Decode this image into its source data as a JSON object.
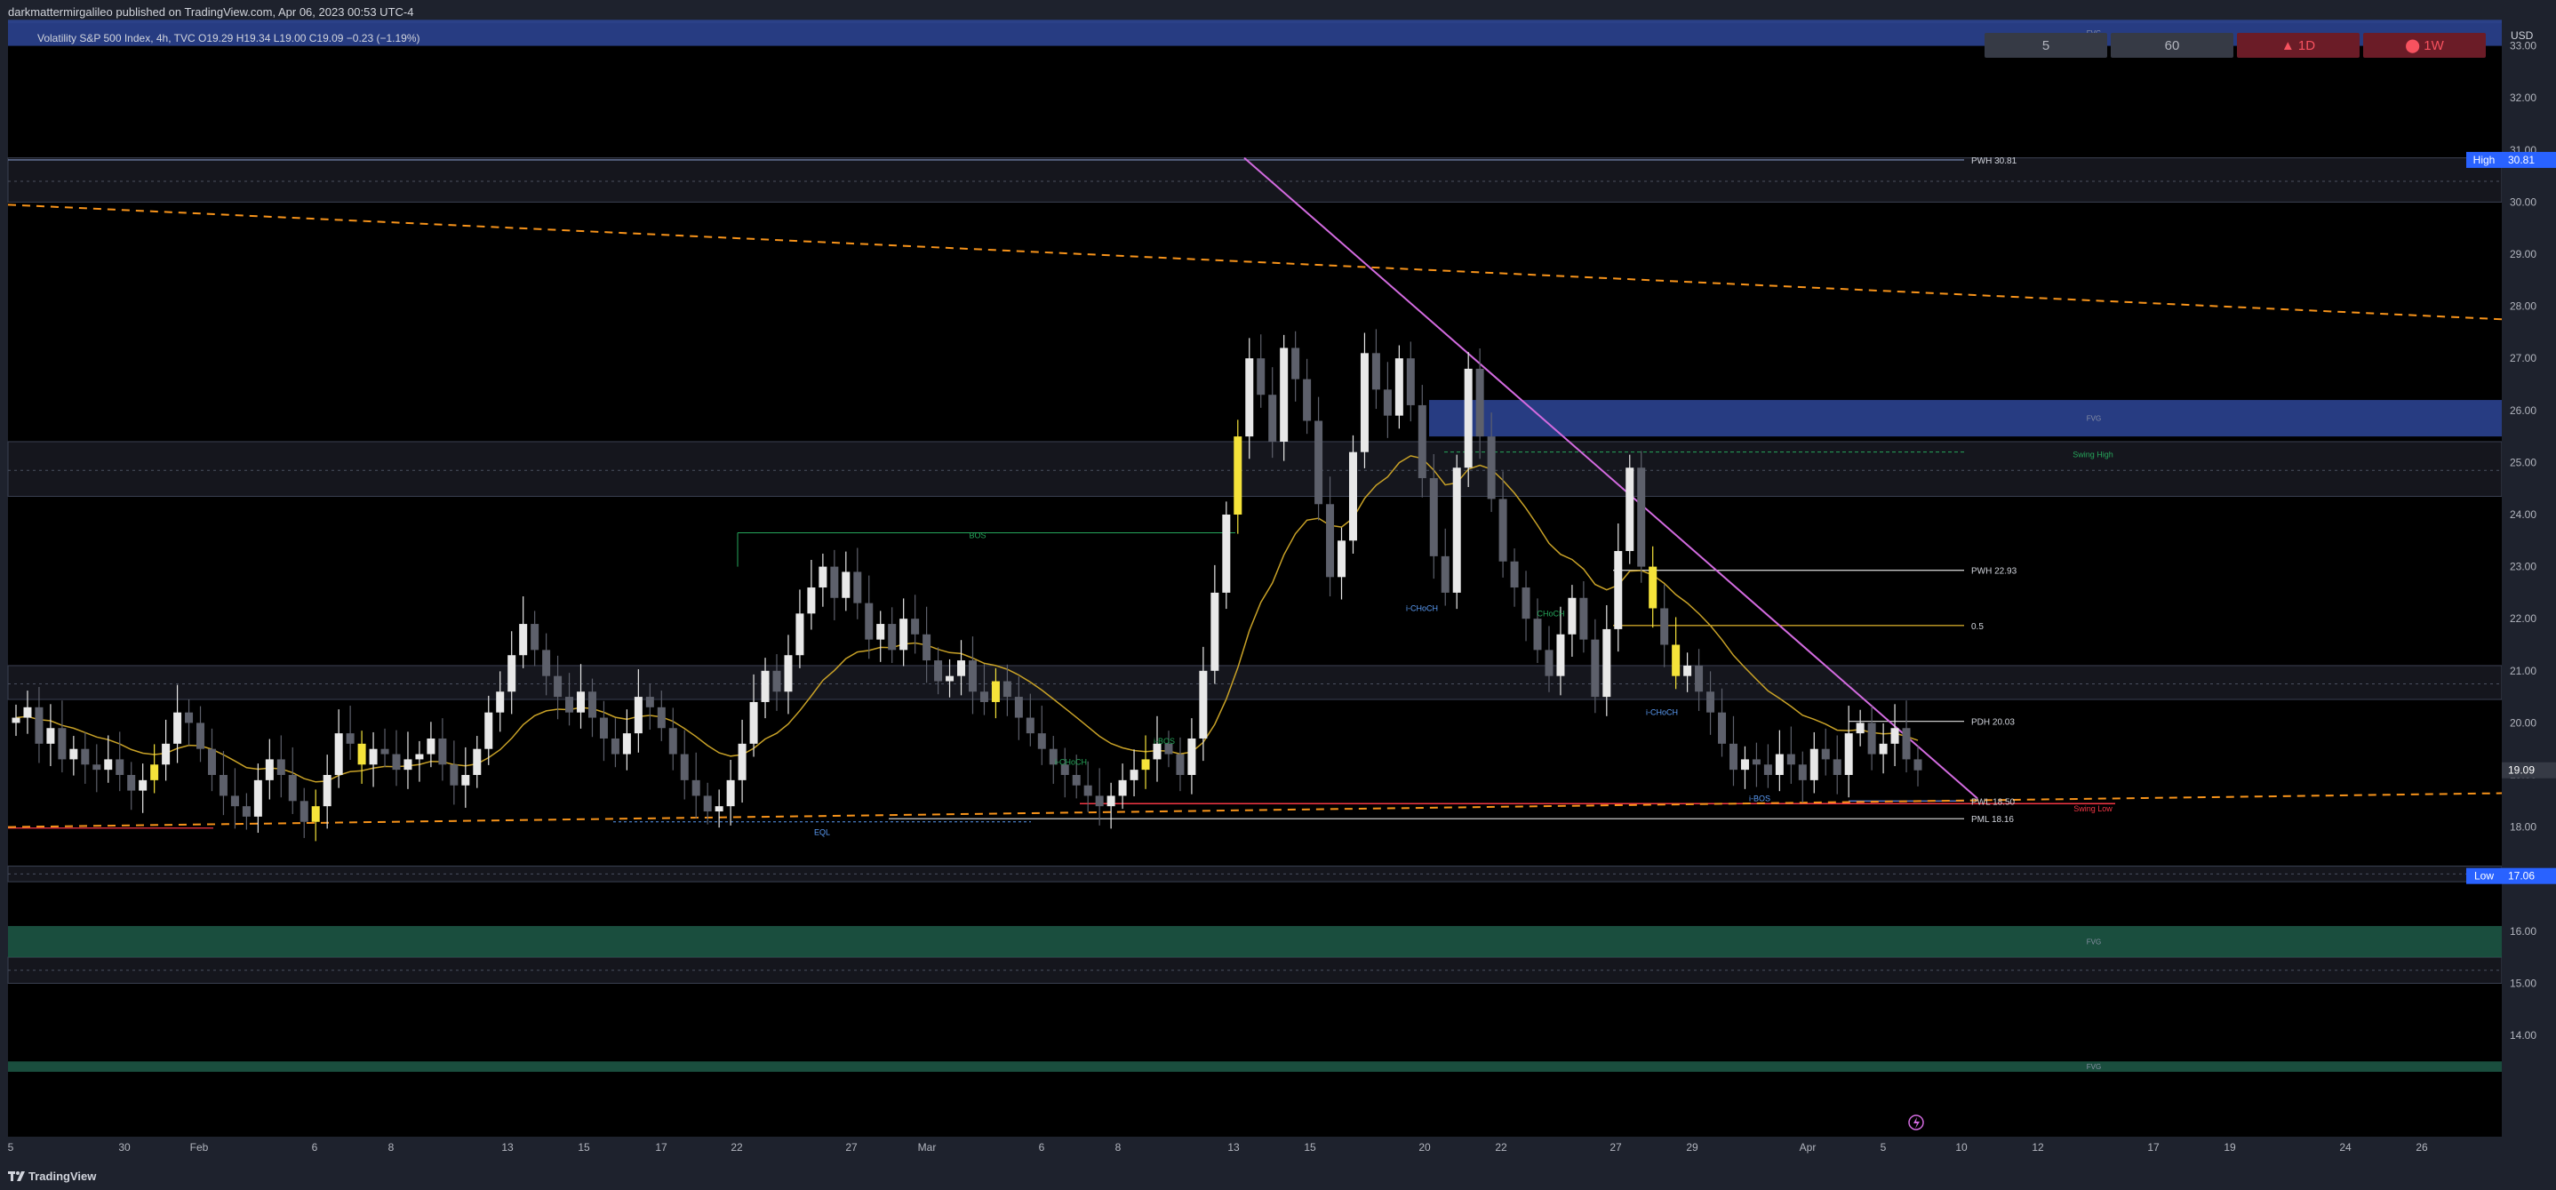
{
  "header": {
    "published": "darkmattermirgalileo published on TradingView.com, Apr 06, 2023 00:53 UTC-4",
    "symbol_info": "Volatility S&P 500 Index, 4h, TVC  O19.29  H19.34  L19.00  C19.09  −0.23 (−1.19%)"
  },
  "timeframes": [
    {
      "label": "5",
      "bg": "#363a45",
      "fg": "#b2b5be"
    },
    {
      "label": "60",
      "bg": "#363a45",
      "fg": "#b2b5be"
    },
    {
      "label": "▲ 1D",
      "bg": "#6b1c27",
      "fg": "#f7525f"
    },
    {
      "label": "⬤  1W",
      "bg": "#6b1c27",
      "fg": "#f7525f"
    }
  ],
  "footer": {
    "brand": "TradingView",
    "logo_icon": "tradingview-logo-icon"
  },
  "colors": {
    "background": "#000000",
    "panel": "#1e222d",
    "text": "#d1d4dc",
    "bullish_candle": "#e8e8e8",
    "bearish_candle": "#5d606b",
    "highlight_candle": "#f5e33a",
    "ema": "#c9a227",
    "trendline": "#d36be0",
    "dashed_trend": "#f7931a",
    "bearish_fvg": "#2e4699",
    "bullish_fvg": "#1e5c49",
    "bos": "#26a65b",
    "choch": "#5b9cf6",
    "swing_low": "#f23645"
  },
  "chart_data": {
    "type": "candlestick",
    "title": "Volatility S&P 500 Index, 4h, TVC",
    "currency": "USD",
    "ylim": [
      13.1,
      33.8
    ],
    "y_ticks": [
      "14.00",
      "15.00",
      "16.00",
      "17.00",
      "18.00",
      "19.00",
      "20.00",
      "21.00",
      "22.00",
      "23.00",
      "24.00",
      "25.00",
      "26.00",
      "27.00",
      "28.00",
      "29.00",
      "30.00",
      "31.00",
      "32.00",
      "33.00"
    ],
    "x_ticks": [
      "5",
      "30",
      "Feb",
      "6",
      "8",
      "13",
      "15",
      "17",
      "22",
      "27",
      "Mar",
      "6",
      "8",
      "13",
      "15",
      "20",
      "22",
      "27",
      "29",
      "Apr",
      "5",
      "10",
      "12",
      "17",
      "19",
      "24",
      "26"
    ],
    "ohlc": {
      "open": 19.29,
      "high": 19.34,
      "low": 19.0,
      "close": 19.09,
      "change": "−0.23 (−1.19%)"
    },
    "price_labels": [
      {
        "label": "High",
        "value": "30.81",
        "price": 30.81,
        "color": "#2962ff"
      },
      {
        "label": "",
        "value": "19.09",
        "price": 19.09,
        "color": "#363a45"
      },
      {
        "label": "Low",
        "value": "17.06",
        "price": 17.06,
        "color": "#2962ff"
      }
    ],
    "key_levels": [
      {
        "label": "PWH 30.81",
        "price": 30.81
      },
      {
        "label": "PWH 22.93",
        "price": 22.93
      },
      {
        "label": "0.5",
        "price": 21.87
      },
      {
        "label": "PDH 20.03",
        "price": 20.03
      },
      {
        "label": "PWL 18.50",
        "price": 18.5
      },
      {
        "label": "PML 18.16",
        "price": 18.16
      }
    ],
    "zones": [
      {
        "label": "FVG",
        "from": 33.0,
        "to": 33.5,
        "type": "bearish"
      },
      {
        "label": "FVG",
        "from": 25.5,
        "to": 26.2,
        "type": "bearish"
      },
      {
        "label": "FVG",
        "from": 15.5,
        "to": 16.1,
        "type": "bullish"
      },
      {
        "label": "FVG",
        "from": 13.3,
        "to": 13.5,
        "type": "bullish"
      }
    ],
    "structure_labels": [
      {
        "label": "BOS",
        "price": 23.6
      },
      {
        "label": "Swing High",
        "price": 25.15
      },
      {
        "label": "Swing Low",
        "price": 18.35
      },
      {
        "label": "EQL",
        "price": 17.9
      },
      {
        "label": "i-CHoCH",
        "price": 22.2
      },
      {
        "label": "i-CHoCH",
        "price": 20.2
      },
      {
        "label": "i-CHoCH",
        "price": 19.25
      },
      {
        "label": "CHoCH",
        "price": 22.1
      },
      {
        "label": "i-BOS",
        "price": 19.65
      },
      {
        "label": "i-BOS",
        "price": 18.55
      }
    ]
  }
}
